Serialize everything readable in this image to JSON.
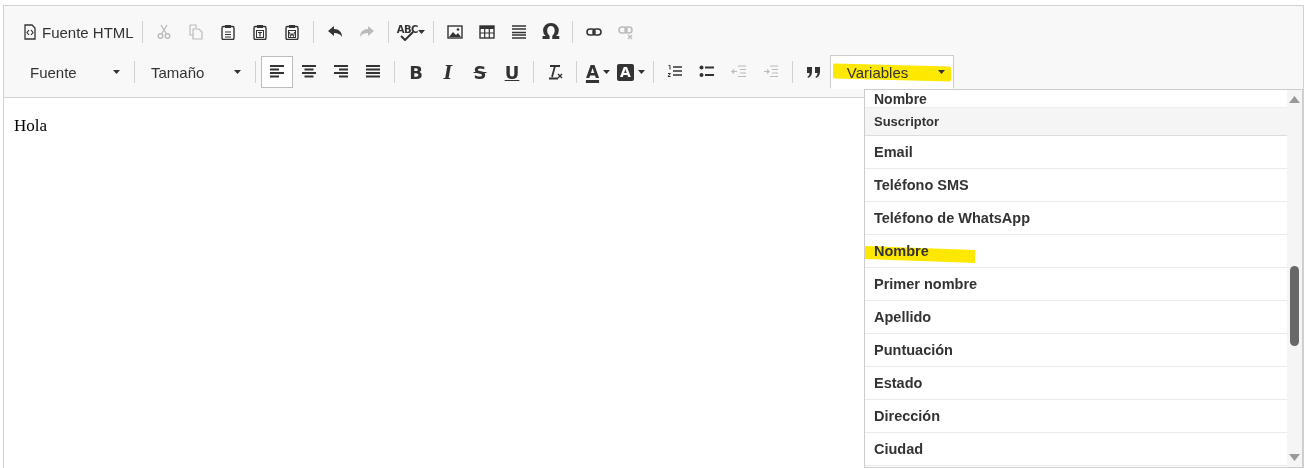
{
  "toolbar": {
    "rows": [
      {
        "groups": [
          {
            "items": [
              {
                "kind": "source",
                "label": "Fuente HTML",
                "disabled": false,
                "pressed": false
              }
            ]
          },
          {
            "items": [
              {
                "kind": "cut",
                "disabled": true,
                "pressed": false
              },
              {
                "kind": "copy",
                "disabled": true,
                "pressed": false
              },
              {
                "kind": "paste",
                "disabled": false,
                "pressed": false
              },
              {
                "kind": "paste-text",
                "disabled": false,
                "pressed": false
              },
              {
                "kind": "paste-word",
                "disabled": false,
                "pressed": false
              }
            ]
          },
          {
            "items": [
              {
                "kind": "undo",
                "disabled": false,
                "pressed": false
              },
              {
                "kind": "redo",
                "disabled": true,
                "pressed": false
              }
            ]
          },
          {
            "items": [
              {
                "kind": "spellcheck",
                "label": "ABC",
                "disabled": false
              }
            ]
          },
          {
            "items": [
              {
                "kind": "image",
                "disabled": false,
                "pressed": false
              },
              {
                "kind": "table",
                "disabled": false,
                "pressed": false
              },
              {
                "kind": "rule",
                "disabled": false,
                "pressed": false
              },
              {
                "kind": "glyph",
                "label": "Ω",
                "disabled": false,
                "pressed": false
              }
            ]
          },
          {
            "items": [
              {
                "kind": "link",
                "disabled": false,
                "pressed": false
              },
              {
                "kind": "unlink",
                "disabled": true,
                "pressed": false
              }
            ]
          }
        ]
      },
      {
        "groups": [
          {
            "items": [
              {
                "kind": "combo",
                "label": "Fuente",
                "open": false,
                "highlighted": false
              }
            ]
          },
          {
            "items": [
              {
                "kind": "combo",
                "label": "Tamaño",
                "open": false,
                "highlighted": false
              }
            ]
          },
          {
            "items": [
              {
                "kind": "align-left",
                "disabled": false,
                "pressed": true
              },
              {
                "kind": "align-center",
                "disabled": false,
                "pressed": false
              },
              {
                "kind": "align-right",
                "disabled": false,
                "pressed": false
              },
              {
                "kind": "justify",
                "disabled": false,
                "pressed": false
              }
            ]
          },
          {
            "items": [
              {
                "kind": "bold",
                "label": "B",
                "disabled": false,
                "pressed": false
              },
              {
                "kind": "italic",
                "label": "I",
                "disabled": false,
                "pressed": false
              },
              {
                "kind": "strike",
                "label": "S",
                "disabled": false,
                "pressed": false
              },
              {
                "kind": "underline",
                "label": "U",
                "disabled": false,
                "pressed": false
              }
            ]
          },
          {
            "items": [
              {
                "kind": "remove-format",
                "disabled": false,
                "pressed": false
              }
            ]
          },
          {
            "items": [
              {
                "kind": "text-color",
                "label": "A",
                "disabled": false,
                "pressed": false
              },
              {
                "kind": "bg-color",
                "label": "A",
                "disabled": false,
                "pressed": false
              }
            ]
          },
          {
            "items": [
              {
                "kind": "numbered-list",
                "disabled": false,
                "pressed": false
              },
              {
                "kind": "bullet-list",
                "disabled": false,
                "pressed": false
              },
              {
                "kind": "outdent",
                "disabled": true,
                "pressed": false
              },
              {
                "kind": "indent",
                "disabled": true,
                "pressed": false
              }
            ]
          },
          {
            "items": [
              {
                "kind": "blockquote",
                "disabled": false,
                "pressed": false
              },
              {
                "kind": "combo",
                "label": "Variables",
                "open": true,
                "highlighted": true
              }
            ]
          }
        ]
      }
    ]
  },
  "editor": {
    "text": "Hola"
  },
  "variables_menu": {
    "cut_item": "Nombre",
    "group_label": "Suscriptor",
    "items": [
      {
        "label": "Email",
        "highlighted": false
      },
      {
        "label": "Teléfono SMS",
        "highlighted": false
      },
      {
        "label": "Teléfono de WhatsApp",
        "highlighted": false
      },
      {
        "label": "Nombre",
        "highlighted": true
      },
      {
        "label": "Primer nombre",
        "highlighted": false
      },
      {
        "label": "Apellido",
        "highlighted": false
      },
      {
        "label": "Puntuación",
        "highlighted": false
      },
      {
        "label": "Estado",
        "highlighted": false
      },
      {
        "label": "Dirección",
        "highlighted": false
      },
      {
        "label": "Ciudad",
        "highlighted": false
      }
    ]
  }
}
